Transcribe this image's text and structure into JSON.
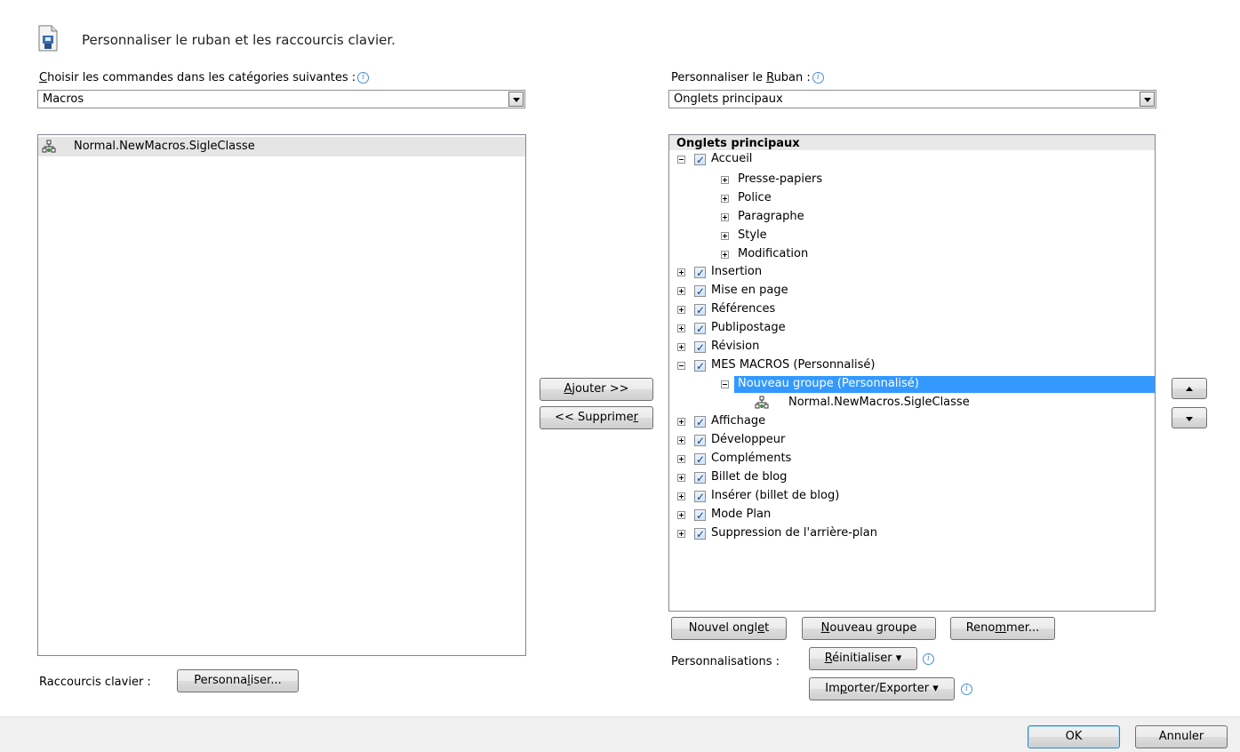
{
  "header": {
    "title": "Personnaliser le ruban et les raccourcis clavier."
  },
  "left": {
    "label_prefix": "C",
    "label_rest": "hoisir les commandes dans les catégories suivantes :",
    "dropdown_value": "Macros",
    "items": [
      "Normal.NewMacros.SigleClasse"
    ],
    "shortcut_label": "Raccourcis clavier :",
    "customize_prefix": "Personna",
    "customize_u": "l",
    "customize_suffix": "iser..."
  },
  "middle": {
    "add_u": "A",
    "add_rest": "jouter >>",
    "remove_prefix": "<< Supprime",
    "remove_u": "r"
  },
  "right": {
    "label_prefix": "Personnaliser le ",
    "label_u": "R",
    "label_rest": "uban :",
    "dropdown_value": "Onglets principaux",
    "tree_header": "Onglets principaux",
    "tabs": {
      "accueil": "Accueil",
      "presse": "Presse-papiers",
      "police": "Police",
      "paragraphe": "Paragraphe",
      "style": "Style",
      "modification": "Modification",
      "insertion": "Insertion",
      "mise": "Mise en page",
      "references": "Références",
      "publipostage": "Publipostage",
      "revision": "Révision",
      "mesmacros": "MES MACROS (Personnalisé)",
      "nouveaugroupe": "Nouveau groupe (Personnalisé)",
      "macroitem": "Normal.NewMacros.SigleClasse",
      "affichage": "Affichage",
      "developpeur": "Développeur",
      "complements": "Compléments",
      "billet": "Billet de blog",
      "inserer": "Insérer (billet de blog)",
      "modeplan": "Mode Plan",
      "suppression": "Suppression de l'arrière-plan"
    },
    "new_tab_prefix": "Nouvel ongl",
    "new_tab_u": "e",
    "new_tab_suffix": "t",
    "new_group_u": "N",
    "new_group_rest": "ouveau groupe",
    "rename_prefix": "Reno",
    "rename_u": "m",
    "rename_suffix": "mer...",
    "customizations_label": "Personnalisations :",
    "reset_u": "R",
    "reset_rest": "éinitialiser",
    "import_prefix": "Im",
    "import_u": "p",
    "import_rest": "orter/Exporter"
  },
  "footer": {
    "ok": "OK",
    "cancel": "Annuler"
  },
  "colors": {
    "selection": "#3399ff",
    "footer_bg": "#f0f0f0",
    "info_icon": "#4a8fd8"
  }
}
